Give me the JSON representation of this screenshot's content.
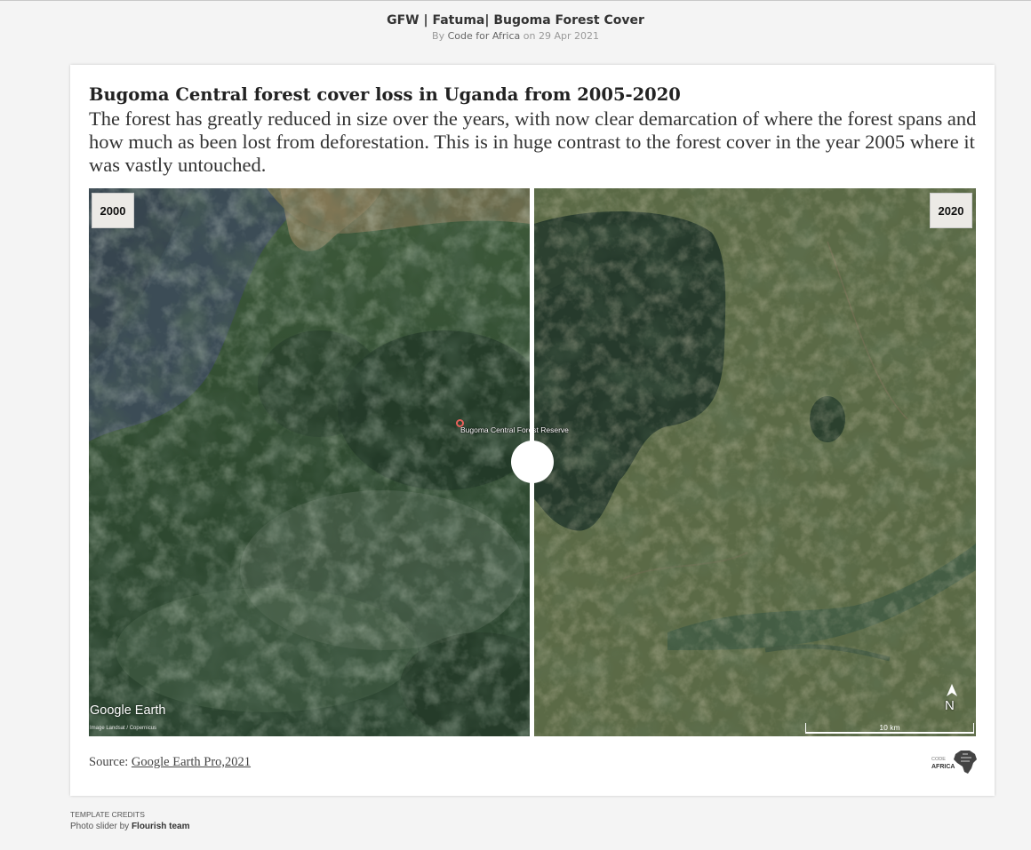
{
  "header": {
    "title": "GFW | Fatuma| Bugoma Forest Cover",
    "by": "By",
    "author": "Code for Africa",
    "on": "on 29 Apr 2021"
  },
  "card": {
    "heading": "Bugoma Central forest cover loss in Uganda from 2005-2020",
    "description": "The forest has greatly reduced in size over the years, with now clear demarcation of where the forest spans and how much as been lost from deforestation. This is in huge contrast to the forest cover in the year 2005 where it was vastly untouched."
  },
  "slider": {
    "left_label": "2000",
    "right_label": "2020",
    "position_fraction": 0.5,
    "left_image": {
      "logo_text": "Google Earth",
      "imagery_credit": "Image Landsat / Copernicus",
      "place_label": "Bugoma Central Forest Reserve"
    },
    "right_image": {
      "north_label": "N",
      "scale_label": "10 km"
    }
  },
  "source": {
    "prefix": "Source:",
    "link_text": "Google Earth Pro,2021"
  },
  "logo": {
    "code_text": "CODE",
    "africa_text": "AFRICA"
  },
  "credits": {
    "heading": "TEMPLATE CREDITS",
    "text": "Photo slider by",
    "team": "Flourish team"
  },
  "colors": {
    "page_background": "#f4f4f4",
    "card_background": "#ffffff",
    "forest_dark": "#263a2c",
    "farmland": "#5e6b47",
    "lake": "#3f4e57"
  }
}
